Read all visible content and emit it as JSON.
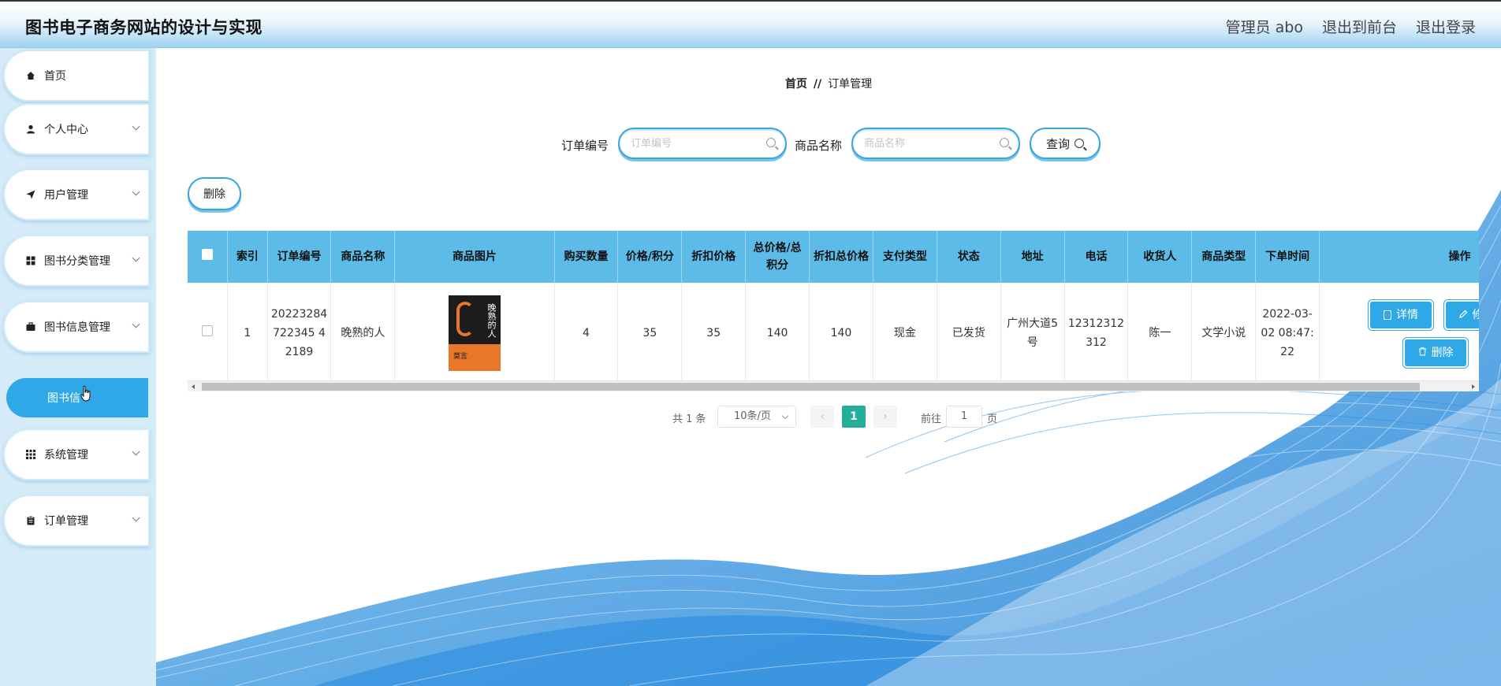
{
  "header": {
    "title": "图书电子商务网站的设计与实现",
    "admin_label": "管理员 abo",
    "to_frontend": "退出到前台",
    "logout": "退出登录"
  },
  "sidebar": {
    "items": [
      {
        "label": "首页",
        "icon": "home-icon"
      },
      {
        "label": "个人中心",
        "icon": "user-icon"
      },
      {
        "label": "用户管理",
        "icon": "send-icon"
      },
      {
        "label": "图书分类管理",
        "icon": "grid-icon"
      },
      {
        "label": "图书信息管理",
        "icon": "briefcase-icon"
      },
      {
        "label": "系统管理",
        "icon": "apps-icon"
      },
      {
        "label": "订单管理",
        "icon": "clipboard-icon"
      }
    ],
    "active_submenu": "图书信"
  },
  "breadcrumb": {
    "home": "首页",
    "separator": "//",
    "current": "订单管理"
  },
  "search": {
    "order_no_label": "订单编号",
    "order_no_placeholder": "订单编号",
    "product_name_label": "商品名称",
    "product_name_placeholder": "商品名称",
    "query_button": "查询"
  },
  "toolbar": {
    "delete_label": "删除"
  },
  "table": {
    "headers": [
      "索引",
      "订单编号",
      "商品名称",
      "商品图片",
      "购买数量",
      "价格/积分",
      "折扣价格",
      "总价格/总积分",
      "折扣总价格",
      "支付类型",
      "状态",
      "地址",
      "电话",
      "收货人",
      "商品类型",
      "下单时间",
      "操作"
    ],
    "rows": [
      {
        "index": "1",
        "order_no": "20223284722345 42189",
        "product_name": "晚熟的人",
        "image_alt": "晚熟的人 book cover",
        "cover_title": "晚熟的人",
        "cover_author": "莫言",
        "quantity": "4",
        "price": "35",
        "discount_price": "35",
        "total_price": "140",
        "discount_total": "140",
        "pay_type": "现金",
        "status": "已发货",
        "address": "广州大道5号",
        "phone": "12312312312",
        "receiver": "陈一",
        "product_type": "文学小说",
        "order_time": "2022-03-02 08:47:22",
        "actions": {
          "detail": "详情",
          "edit": "修改",
          "delete": "删除"
        }
      }
    ]
  },
  "pagination": {
    "total": "共 1 条",
    "page_size": "10条/页",
    "prev": "‹",
    "current_page": "1",
    "next": "›",
    "goto_label": "前往",
    "goto_value": "1",
    "goto_unit": "页"
  },
  "colors": {
    "accent": "#2ea8e6",
    "header_bg": "#5dbbe8",
    "pager_active": "#22b09a",
    "sidebar_bg": "#d5ebf7"
  }
}
